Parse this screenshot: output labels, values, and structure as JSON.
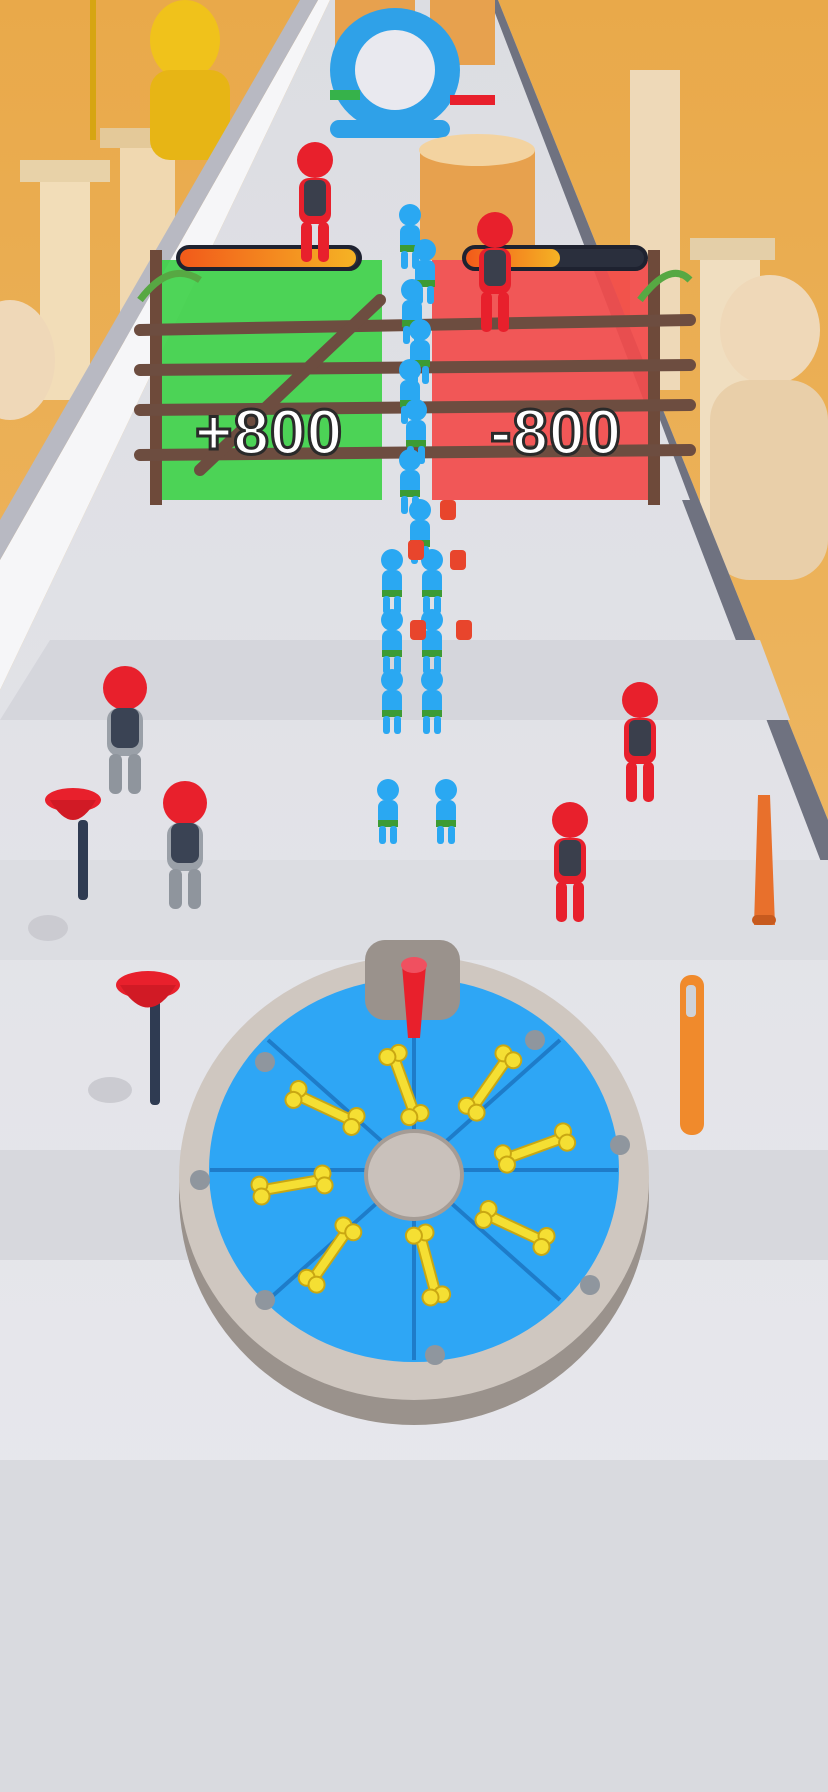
{
  "hud": {
    "left_health_fraction": 0.99,
    "right_health_fraction": 0.53,
    "bar_fill_color": "#f5a623",
    "bar_track_color": "#2a2f3d"
  },
  "gates": {
    "left": {
      "value": "+800",
      "color": "#3fd14a"
    },
    "right": {
      "value": "-800",
      "color": "#f24b4b"
    }
  },
  "colors": {
    "background": "#e7a94d",
    "track": "#f0f0f2",
    "player_army": "#2aa8f2",
    "enemy": "#e8202c",
    "wheel_segment": "#2ea6f5",
    "bone": "#f5df33"
  },
  "items": {
    "spin_wheel_icon": "bone-wheel",
    "weapons": [
      "plunger",
      "baseball-bat",
      "plunger",
      "torch"
    ]
  }
}
